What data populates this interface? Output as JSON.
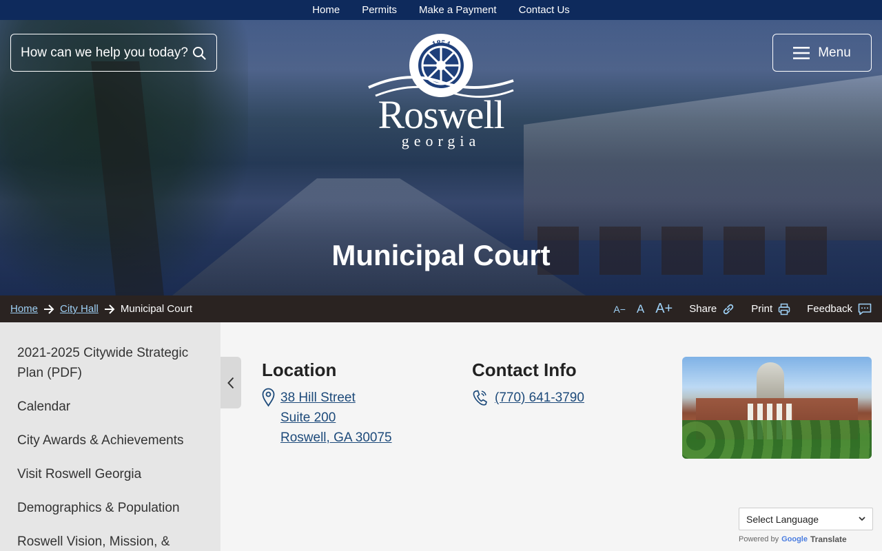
{
  "topnav": [
    "Home",
    "Permits",
    "Make a Payment",
    "Contact Us"
  ],
  "header": {
    "search_placeholder": "How can we help you today?",
    "menu_label": "Menu",
    "logo": {
      "year": "1854",
      "wordmark": "Roswell",
      "subtitle": "georgia"
    },
    "page_title": "Municipal Court"
  },
  "breadcrumb": {
    "items": [
      {
        "label": "Home",
        "link": true
      },
      {
        "label": "City Hall",
        "link": true
      },
      {
        "label": "Municipal Court",
        "link": false
      }
    ]
  },
  "tools": {
    "font_decrease": "A−",
    "font_default": "A",
    "font_increase": "A+",
    "share": "Share",
    "print": "Print",
    "feedback": "Feedback"
  },
  "sidebar": {
    "items": [
      "2021-2025 Citywide Strategic Plan (PDF)",
      "Calendar",
      "City Awards & Achievements",
      "Visit Roswell Georgia",
      "Demographics & Population",
      "Roswell Vision, Mission, &"
    ]
  },
  "location": {
    "title": "Location",
    "lines": [
      "38 Hill Street",
      "Suite 200",
      "Roswell, GA 30075"
    ]
  },
  "contact": {
    "title": "Contact Info",
    "phone": "(770) 641-3790"
  },
  "translate": {
    "select_label": "Select Language",
    "powered_by": "Powered by",
    "google": "Google",
    "translate": "Translate"
  },
  "icons": {
    "search": "search-icon",
    "menu": "hamburger-icon",
    "share": "link-icon",
    "print": "printer-icon",
    "feedback": "chat-icon",
    "location": "map-pin-icon",
    "phone": "phone-icon",
    "collapse": "chevron-left-icon"
  },
  "colors": {
    "topbar": "#0e2a5c",
    "breadcrumb_bar": "#2a2321",
    "link": "#1d4a7a",
    "crumb_link": "#9ed0f5"
  }
}
